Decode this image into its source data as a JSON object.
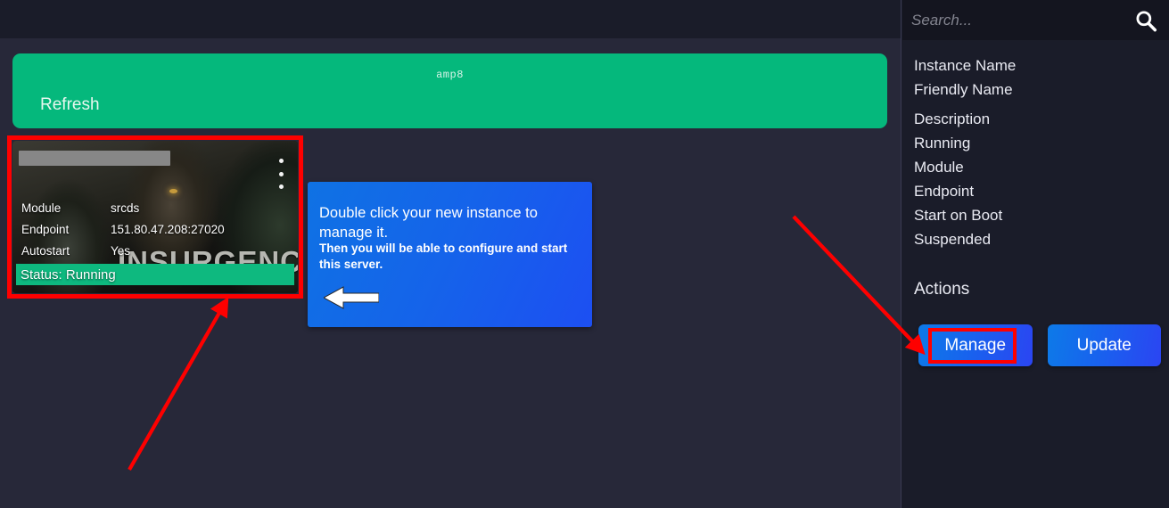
{
  "window": {
    "background_color": "#272839",
    "sidebar_color": "#1a1c29",
    "accent_green": "#05b87c",
    "accent_blue": "#1563ea",
    "annotation_red": "#fe0000"
  },
  "search": {
    "placeholder": "Search...",
    "value": "",
    "icon": "search-icon"
  },
  "sidebar": {
    "properties": [
      {
        "label": "Instance Name"
      },
      {
        "label": "Friendly Name"
      },
      {
        "label": "Description"
      },
      {
        "label": "Running"
      },
      {
        "label": "Module"
      },
      {
        "label": "Endpoint"
      },
      {
        "label": "Start on Boot"
      },
      {
        "label": "Suspended"
      }
    ],
    "actions_title": "Actions",
    "buttons": [
      {
        "label": "Manage",
        "highlighted": true
      },
      {
        "label": "Update",
        "highlighted": false
      }
    ]
  },
  "header_bar": {
    "refresh_label": "Refresh",
    "code_label": "amp8"
  },
  "instance_card": {
    "name_redacted": true,
    "kebab_icon": "kebab-menu-icon",
    "art_title": "INSURGENC",
    "rows": [
      {
        "key": "Module",
        "value": "srcds"
      },
      {
        "key": "Endpoint",
        "value": "151.80.47.208:27020"
      },
      {
        "key": "Autostart",
        "value": "Yes"
      }
    ],
    "status": "Status: Running"
  },
  "callout": {
    "headline": "Double click your new instance to manage it.",
    "subtext": "Then you will be able to configure and start this server.",
    "arrow_icon": "arrow-left-icon"
  },
  "annotations": {
    "card_box": "red-rectangle-around-instance-card",
    "manage_box": "red-rectangle-around-manage-button",
    "arrow_to_card": "red-arrow-pointing-to-instance-card",
    "arrow_to_manage": "red-arrow-pointing-to-manage-button"
  }
}
